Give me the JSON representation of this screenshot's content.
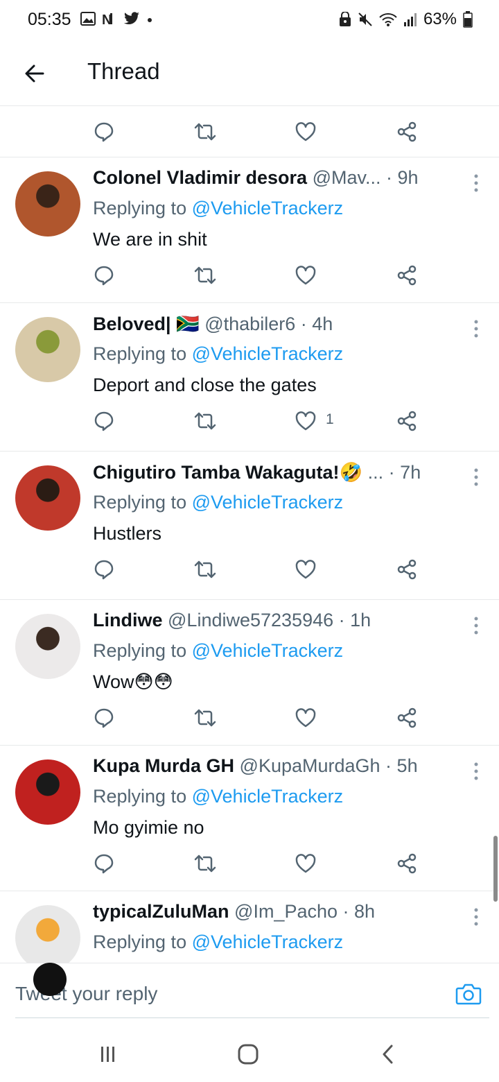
{
  "status": {
    "time": "05:35",
    "battery": "63%"
  },
  "header": {
    "title": "Thread"
  },
  "tweets": [
    {
      "name": "Colonel Vladimir desora",
      "handle": "@Mav...",
      "time": "9h",
      "reply_prefix": "Replying to",
      "mention": "@VehicleTrackerz",
      "text": "We are in shit",
      "likes": ""
    },
    {
      "name": "Beloved| 🇿🇦",
      "handle": "@thabiler6",
      "time": "4h",
      "reply_prefix": "Replying to",
      "mention": "@VehicleTrackerz",
      "text": "Deport and close the gates",
      "likes": "1"
    },
    {
      "name": "Chigutiro Tamba Wakaguta!🤣",
      "handle": "...",
      "time": "7h",
      "reply_prefix": "Replying to",
      "mention": "@VehicleTrackerz",
      "text": "Hustlers",
      "likes": ""
    },
    {
      "name": "Lindiwe",
      "handle": "@Lindiwe57235946",
      "time": "1h",
      "reply_prefix": "Replying to",
      "mention": "@VehicleTrackerz",
      "text": "Wow😳😳",
      "likes": ""
    },
    {
      "name": "Kupa Murda GH",
      "handle": "@KupaMurdaGh",
      "time": "5h",
      "reply_prefix": "Replying to",
      "mention": "@VehicleTrackerz",
      "text": "Mo gyimie no",
      "likes": ""
    },
    {
      "name": "typicalZuluMan",
      "handle": "@Im_Pacho",
      "time": "8h",
      "reply_prefix": "Replying to",
      "mention": "@VehicleTrackerz",
      "text": "",
      "likes": ""
    }
  ],
  "reply_box": {
    "placeholder": "Tweet your reply"
  },
  "colors": {
    "link": "#1d9bf0",
    "secondary": "#536471",
    "text": "#0f1419"
  }
}
